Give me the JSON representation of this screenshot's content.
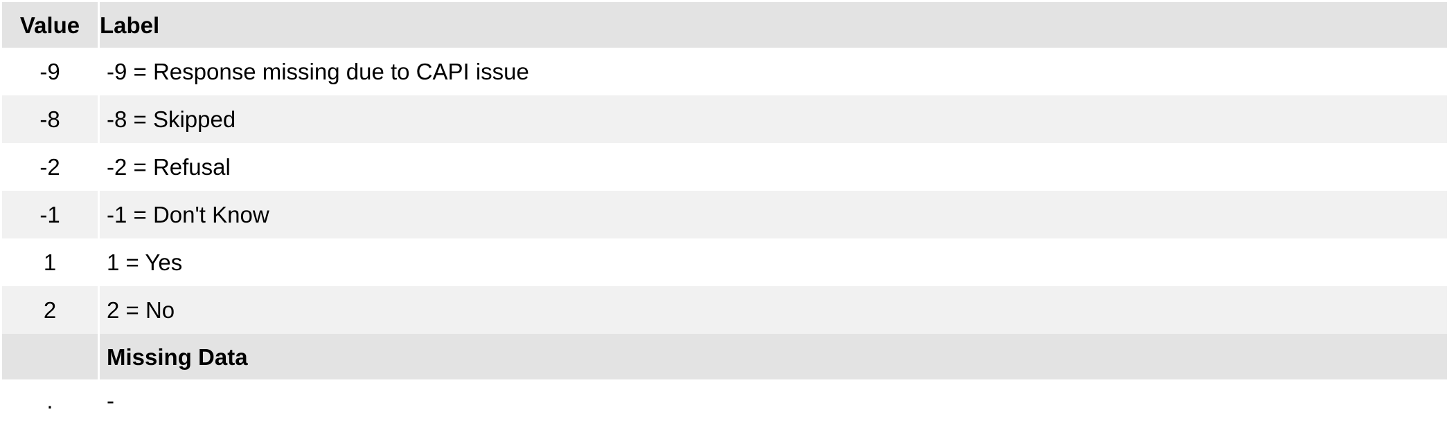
{
  "table": {
    "header": {
      "value": "Value",
      "label": "Label"
    },
    "rows": [
      {
        "value": "-9",
        "label": "-9 = Response missing due to CAPI issue"
      },
      {
        "value": "-8",
        "label": "-8 = Skipped"
      },
      {
        "value": "-2",
        "label": "-2 = Refusal"
      },
      {
        "value": "-1",
        "label": "-1 = Don't Know"
      },
      {
        "value": "1",
        "label": "1 = Yes"
      },
      {
        "value": "2",
        "label": "2 = No"
      }
    ],
    "section": {
      "value": "",
      "label": "Missing Data"
    },
    "missing_row": {
      "value": ".",
      "label": "-"
    }
  },
  "colors": {
    "header_bg": "#e3e3e3",
    "row_alt_bg": "#f1f1f1",
    "row_bg": "#ffffff"
  }
}
